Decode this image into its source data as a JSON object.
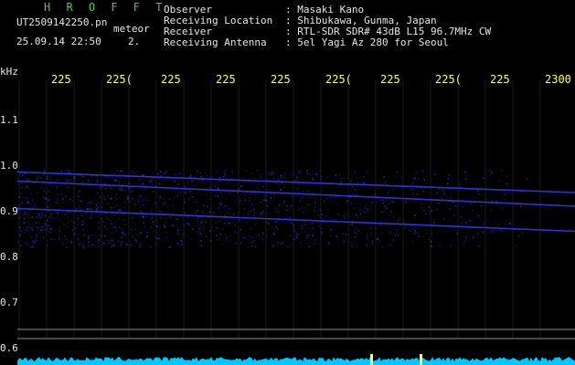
{
  "header": {
    "brand": "H R O F F T",
    "filename": "UT2509142250.pn",
    "filename_suffix": "meteor",
    "timestamp": "25.09.14 22:50",
    "mode": "2."
  },
  "info": [
    {
      "label": "Observer",
      "value": ": Masaki Kano"
    },
    {
      "label": "Receiving Location",
      "value": ": Shibukawa, Gunma, Japan"
    },
    {
      "label": "Receiver",
      "value": ": RTL-SDR SDR# 43dB L15 96.7MHz CW"
    },
    {
      "label": "Receiving Antenna",
      "value": ": 5el Yagi Az 280 for Seoul"
    }
  ],
  "chart_data": {
    "type": "heatmap",
    "ylabel": "kHz",
    "x_tick_labels": [
      "225",
      "225(",
      "225",
      "225",
      "225",
      "225(",
      "225",
      "225(",
      "225",
      "2300"
    ],
    "y_tick_labels": [
      "1.1",
      "1.0",
      "0.9",
      "0.8",
      "0.7",
      "0.6"
    ],
    "ylim": [
      0.59,
      1.2
    ],
    "background_color": "#000000",
    "signal_color": "#3b3bff",
    "baseline_color": "#00c8ff",
    "traces": [
      {
        "y_start": 0.985,
        "y_end": 0.94
      },
      {
        "y_start": 0.965,
        "y_end": 0.91
      },
      {
        "y_start": 0.905,
        "y_end": 0.855
      }
    ]
  }
}
